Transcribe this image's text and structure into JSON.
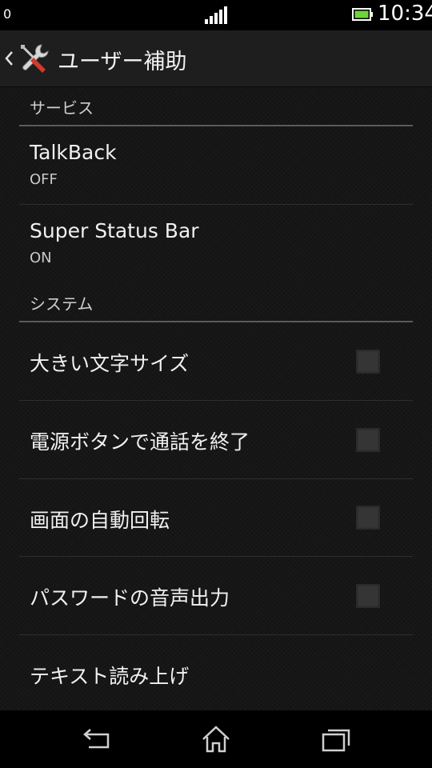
{
  "status_bar": {
    "left_indicator": "0",
    "time": "10:34",
    "battery_color": "#6ed43a"
  },
  "action_bar": {
    "title": "ユーザー補助",
    "icon": "tools-icon"
  },
  "sections": [
    {
      "header": "サービス",
      "items": [
        {
          "title": "TalkBack",
          "summary": "OFF"
        },
        {
          "title": "Super Status Bar",
          "summary": "ON"
        }
      ]
    },
    {
      "header": "システム",
      "items": [
        {
          "title": "大きい文字サイズ",
          "checked": false
        },
        {
          "title": "電源ボタンで通話を終了",
          "checked": false
        },
        {
          "title": "画面の自動回転",
          "checked": false
        },
        {
          "title": "パスワードの音声出力",
          "checked": false
        },
        {
          "title": "テキスト読み上げ"
        }
      ]
    }
  ],
  "nav_bar": {
    "buttons": [
      "back-icon",
      "home-icon",
      "recent-apps-icon"
    ]
  }
}
